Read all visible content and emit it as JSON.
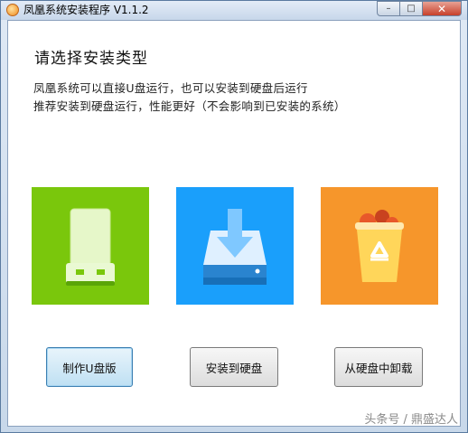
{
  "window": {
    "title": "凤凰系统安装程序 V1.1.2",
    "minimize_symbol": "–",
    "maximize_symbol": "□",
    "close_symbol": "✕"
  },
  "content": {
    "heading": "请选择安装类型",
    "description_line1": "凤凰系统可以直接U盘运行，也可以安装到硬盘后运行",
    "description_line2": "推荐安装到硬盘运行，性能更好（不会影响到已安装的系统）"
  },
  "options": [
    {
      "icon": "usb-drive-icon",
      "color": "#7ac70c",
      "button_label": "制作U盘版"
    },
    {
      "icon": "install-to-disk-icon",
      "color": "#1a9ffb",
      "button_label": "安装到硬盘"
    },
    {
      "icon": "recycle-bin-icon",
      "color": "#f6962b",
      "button_label": "从硬盘中卸载"
    }
  ],
  "watermark": "头条号 / 鼎盛达人"
}
